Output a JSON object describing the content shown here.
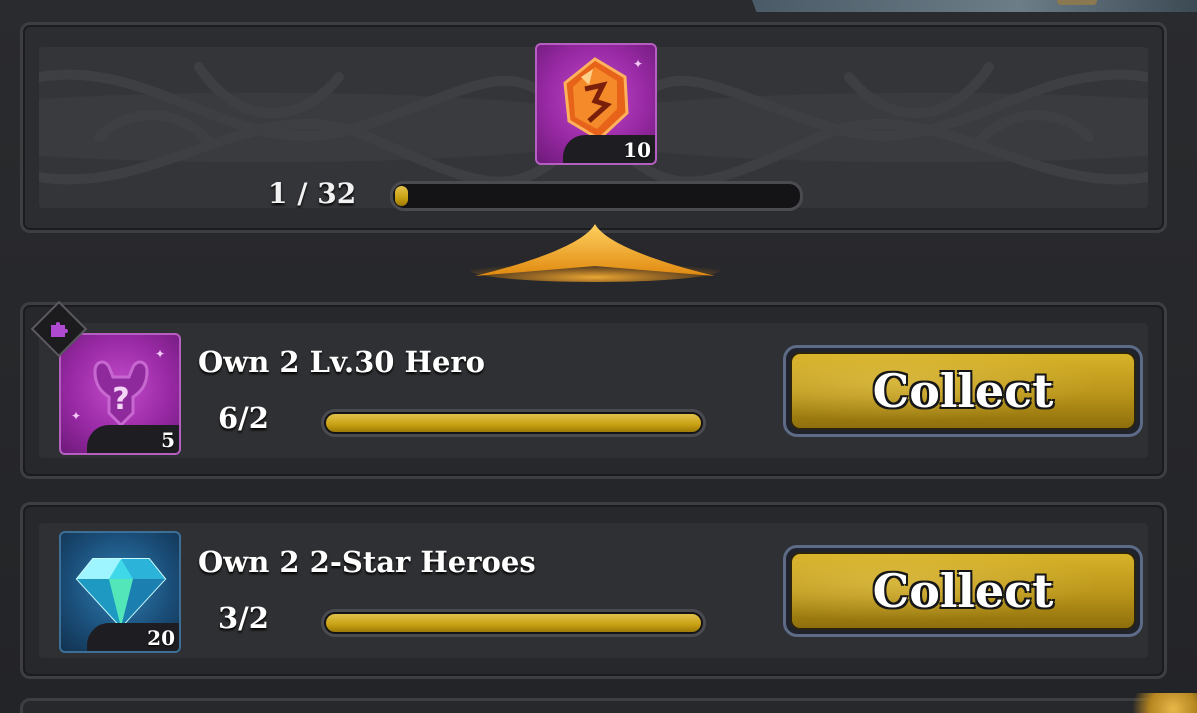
{
  "milestone": {
    "reward": {
      "icon": "fire-crystal-icon",
      "quantity": "10"
    },
    "progress_text": "1 / 32",
    "progress_fraction": 0.03125
  },
  "tasks": [
    {
      "title": "Own 2 Lv.30 Hero",
      "progress_text": "6/2",
      "progress_fraction": 1.0,
      "reward": {
        "icon": "hero-shard-icon",
        "quantity": "5"
      },
      "badge": "puzzle-icon",
      "button_label": "Collect"
    },
    {
      "title": "Own 2 2-Star Heroes",
      "progress_text": "3/2",
      "progress_fraction": 1.0,
      "reward": {
        "icon": "diamond-icon",
        "quantity": "20"
      },
      "button_label": "Collect"
    }
  ],
  "colors": {
    "progress_gold": "#c7a012",
    "button_gold": "#c9a21f",
    "reward_magenta": "#9a2aa6",
    "reward_blue": "#1a4d78"
  }
}
